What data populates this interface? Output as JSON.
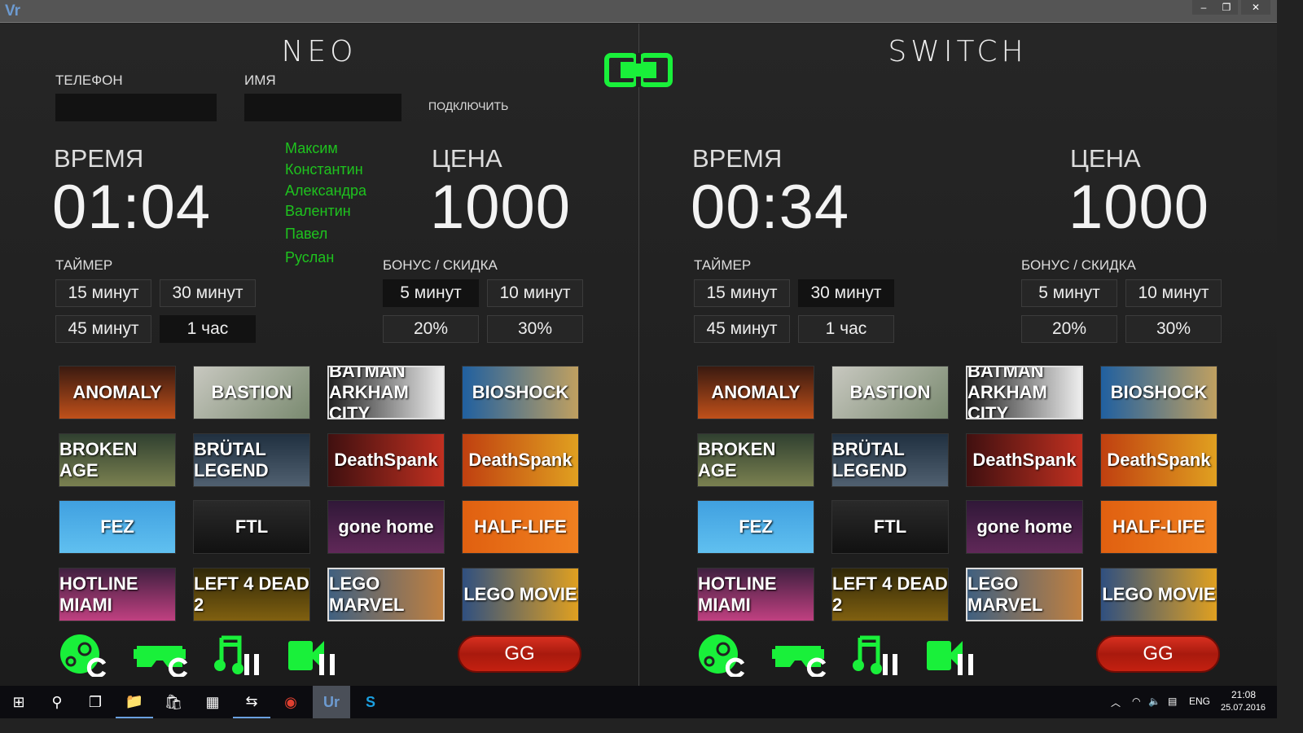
{
  "window": {
    "logo": "Vr",
    "minimize": "–",
    "restore": "❐",
    "close": "✕"
  },
  "connect": {
    "phone_label": "ТЕЛЕФОН",
    "name_label": "ИМЯ",
    "phone_value": "",
    "name_value": "",
    "connect_label": "ПОДКЛЮЧИТЬ",
    "names": [
      "Максим",
      "Константин",
      "Александра",
      "Валентин",
      "Павел",
      "Руслан"
    ]
  },
  "panels": [
    {
      "title": "NEO",
      "time_label": "ВРЕМЯ",
      "time": "01:04",
      "price_label": "ЦЕНА",
      "price": "1000",
      "timer_label": "ТАЙМЕР",
      "timer_buttons": [
        "15 минут",
        "30 минут",
        "45 минут",
        "1 час"
      ],
      "timer_selected": "1 час",
      "bonus_label": "БОНУС / СКИДКА",
      "bonus_buttons": [
        "5 минут",
        "10 минут",
        "20%",
        "30%"
      ],
      "bonus_selected": "5 минут",
      "gg": "GG"
    },
    {
      "title": "SWITCH",
      "time_label": "ВРЕМЯ",
      "time": "00:34",
      "price_label": "ЦЕНА",
      "price": "1000",
      "timer_label": "ТАЙМЕР",
      "timer_buttons": [
        "15 минут",
        "30 минут",
        "45 минут",
        "1 час"
      ],
      "timer_selected": "30 минут",
      "bonus_label": "БОНУС / СКИДКА",
      "bonus_buttons": [
        "5 минут",
        "10 минут",
        "20%",
        "30%"
      ],
      "bonus_selected": "",
      "gg": "GG"
    }
  ],
  "games": [
    {
      "name": "ANOMALY",
      "bg": "linear-gradient(#3a1a10,#c0501a)"
    },
    {
      "name": "BASTION",
      "bg": "linear-gradient(135deg,#c8c8c0,#7a8a70)"
    },
    {
      "name": "BATMAN ARKHAM CITY",
      "bg": "linear-gradient(90deg,#222,#eee)"
    },
    {
      "name": "BIOSHOCK",
      "bg": "linear-gradient(90deg,#2060a0,#c0a060)"
    },
    {
      "name": "BROKEN AGE",
      "bg": "linear-gradient(#304030,#7a8050)"
    },
    {
      "name": "BRÜTAL LEGEND",
      "bg": "linear-gradient(#203040,#506070)"
    },
    {
      "name": "DeathSpank",
      "bg": "linear-gradient(90deg,#401010,#c03020)"
    },
    {
      "name": "DeathSpank",
      "bg": "linear-gradient(90deg,#c04010,#e0a020)"
    },
    {
      "name": "FEZ",
      "bg": "linear-gradient(#40a0e0,#60c0f0)"
    },
    {
      "name": "FTL",
      "bg": "linear-gradient(#2a2a2a,#111)"
    },
    {
      "name": "gone home",
      "bg": "linear-gradient(#301838,#602858)"
    },
    {
      "name": "HALF-LIFE",
      "bg": "linear-gradient(90deg,#e06010,#f08020)"
    },
    {
      "name": "HOTLINE MIAMI",
      "bg": "linear-gradient(#402040,#c04080)"
    },
    {
      "name": "LEFT 4 DEAD 2",
      "bg": "linear-gradient(#302808,#806010)"
    },
    {
      "name": "LEGO MARVEL",
      "bg": "linear-gradient(90deg,#406080,#c08040)"
    },
    {
      "name": "LEGO MOVIE",
      "bg": "linear-gradient(90deg,#305080,#e0a020)"
    }
  ],
  "icons": [
    "steam-restart",
    "vr-headset-restart",
    "music-pause",
    "video-pause"
  ],
  "taskbar": {
    "lang": "ENG",
    "time": "21:08",
    "date": "25.07.2016",
    "apps": [
      "⊞",
      "⚲",
      "❐",
      "📁",
      "🛍",
      "▦",
      "⇆",
      "◉",
      "Ur",
      "S"
    ]
  },
  "colors": {
    "accent": "#19f03a",
    "gg": "#c42010"
  }
}
